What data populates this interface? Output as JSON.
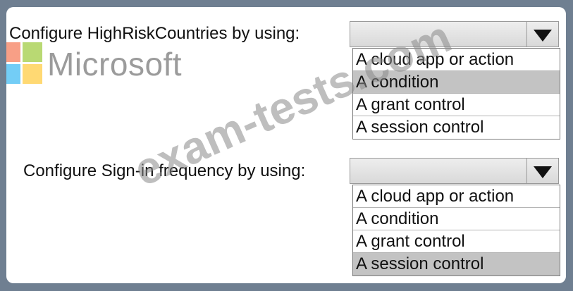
{
  "questions": [
    {
      "label": "Configure HighRiskCountries by using:",
      "selected": "",
      "options": [
        "A cloud app or action",
        "A condition",
        "A grant control",
        "A session control"
      ],
      "highlighted_index": 1
    },
    {
      "label": "Configure Sign-in frequency by using:",
      "selected": "",
      "options": [
        "A cloud app or action",
        "A condition",
        "A grant control",
        "A session control"
      ],
      "highlighted_index": 3
    }
  ],
  "logo": {
    "text": "Microsoft",
    "colors": [
      "#f25022",
      "#7fba00",
      "#00a4ef",
      "#ffb900"
    ]
  },
  "watermark": "exam-tests.com",
  "colors": {
    "background": "#6f7f91",
    "panel": "#ffffff",
    "highlight": "#c3c3c3"
  }
}
